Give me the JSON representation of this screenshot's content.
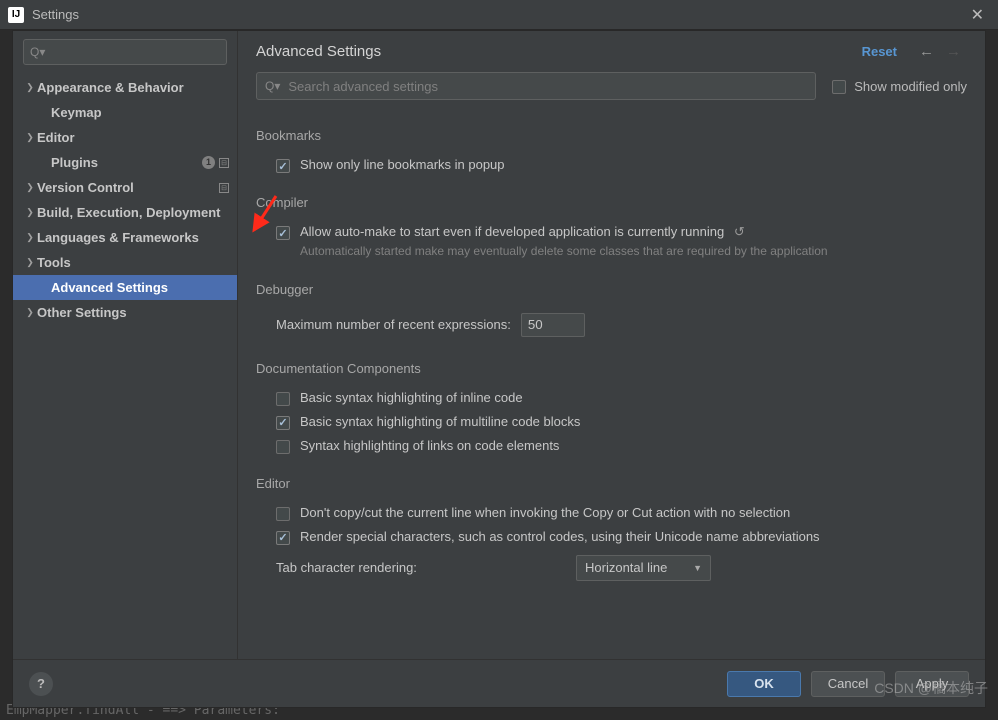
{
  "window": {
    "title": "Settings",
    "close": "✕"
  },
  "sidebar": {
    "search_placeholder": "",
    "items": [
      {
        "label": "Appearance & Behavior",
        "expandable": true,
        "top": true
      },
      {
        "label": "Keymap",
        "expandable": false,
        "top": true,
        "child": true
      },
      {
        "label": "Editor",
        "expandable": true,
        "top": true
      },
      {
        "label": "Plugins",
        "expandable": false,
        "top": true,
        "child": true,
        "badge": "1",
        "sep": true
      },
      {
        "label": "Version Control",
        "expandable": true,
        "top": true,
        "sep": true
      },
      {
        "label": "Build, Execution, Deployment",
        "expandable": true,
        "top": true
      },
      {
        "label": "Languages & Frameworks",
        "expandable": true,
        "top": true
      },
      {
        "label": "Tools",
        "expandable": true,
        "top": true
      },
      {
        "label": "Advanced Settings",
        "expandable": false,
        "top": true,
        "child": true,
        "selected": true
      },
      {
        "label": "Other Settings",
        "expandable": true,
        "top": true
      }
    ]
  },
  "main": {
    "title": "Advanced Settings",
    "reset": "Reset",
    "search_placeholder": "Search advanced settings",
    "show_modified_only": "Show modified only"
  },
  "sections": {
    "bookmarks": {
      "title": "Bookmarks",
      "opt1": "Show only line bookmarks in popup",
      "opt1_checked": true
    },
    "compiler": {
      "title": "Compiler",
      "opt1": "Allow auto-make to start even if developed application is currently running",
      "opt1_checked": true,
      "opt1_sub": "Automatically started make may eventually delete some classes that are required by the application"
    },
    "debugger": {
      "title": "Debugger",
      "field1_label": "Maximum number of recent expressions:",
      "field1_value": "50"
    },
    "doc": {
      "title": "Documentation Components",
      "opt1": "Basic syntax highlighting of inline code",
      "opt1_checked": false,
      "opt2": "Basic syntax highlighting of multiline code blocks",
      "opt2_checked": true,
      "opt3": "Syntax highlighting of links on code elements",
      "opt3_checked": false
    },
    "editor": {
      "title": "Editor",
      "opt1": "Don't copy/cut the current line when invoking the Copy or Cut action with no selection",
      "opt1_checked": false,
      "opt2": "Render special characters, such as control codes, using their Unicode name abbreviations",
      "opt2_checked": true,
      "field1_label": "Tab character rendering:",
      "field1_value": "Horizontal line"
    }
  },
  "footer": {
    "ok": "OK",
    "cancel": "Cancel",
    "apply": "Apply",
    "help": "?"
  },
  "watermark": "CSDN @橘本纯子",
  "bg_code": "EmpMapper.findAll - ==> Parameters:"
}
